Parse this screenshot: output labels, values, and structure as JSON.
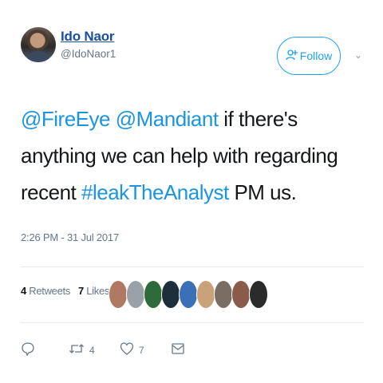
{
  "author": {
    "name": "Ido Naor",
    "handle": "@IdoNaor1"
  },
  "follow_button": {
    "icon": "follow-person-plus-icon",
    "label": "Follow"
  },
  "menu_caret": "⌄",
  "tweet": {
    "segments": [
      {
        "text": "@FireEye",
        "type": "mention"
      },
      {
        "text": " ",
        "type": "text"
      },
      {
        "text": "@Mandiant",
        "type": "mention"
      },
      {
        "text": " if there's anything we can help with regarding recent ",
        "type": "text"
      },
      {
        "text": "#leakTheAnalyst",
        "type": "hashtag"
      },
      {
        "text": " PM us.",
        "type": "text"
      }
    ],
    "timestamp": "2:26 PM - 31 Jul 2017"
  },
  "stats": {
    "retweets_count": "4",
    "retweets_label": "Retweets",
    "likes_count": "7",
    "likes_label": "Likes"
  },
  "likers": [
    {
      "color": "#b07a62"
    },
    {
      "color": "#9aa0a8"
    },
    {
      "color": "#2f6b3a"
    },
    {
      "color": "#1e2e3a"
    },
    {
      "color": "#3b6fb6"
    },
    {
      "color": "#c9a27a"
    },
    {
      "color": "#7a6e64"
    },
    {
      "color": "#8a5a4a"
    },
    {
      "color": "#2b2b2b"
    }
  ],
  "actions": {
    "reply_icon": "reply-icon",
    "retweet_icon": "retweet-icon",
    "retweet_count": "4",
    "like_icon": "heart-icon",
    "like_count": "7",
    "message_icon": "direct-message-icon"
  }
}
